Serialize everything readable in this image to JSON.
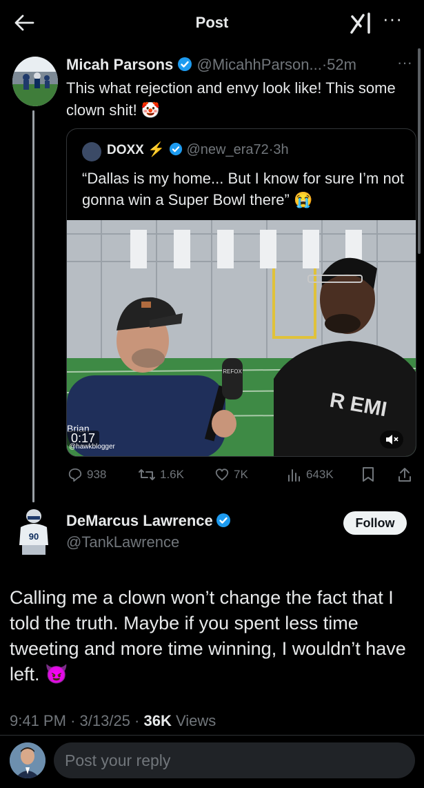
{
  "header": {
    "title": "Post",
    "back_icon": "arrow-left-icon",
    "grok_icon": "grok-icon",
    "more": "···"
  },
  "post1": {
    "name": "Micah Parsons",
    "handle": "@MicahhParson...",
    "sep": "·",
    "time": "52m",
    "more": "···",
    "text": "This what rejection and envy look like! This some clown shit! 🤡",
    "quote": {
      "name": "DOXX",
      "bolt": "⚡",
      "handle": "@new_era72",
      "sep": "·",
      "time": "3h",
      "text": "“Dallas is my home... But I know for sure I’m not gonna win a Super Bowl there” 😭",
      "video": {
        "timer": "0:17",
        "overlay_name": "Brian",
        "overlay_handle": "@hawkblogger",
        "mic_label": "REFOX",
        "hoodie_text": "R EMI",
        "mute_icon": "speaker-muted-icon"
      }
    },
    "actions": {
      "replies": "938",
      "reposts": "1.6K",
      "likes": "7K",
      "views": "643K"
    }
  },
  "post2": {
    "name": "DeMarcus Lawrence",
    "handle": "@TankLawrence",
    "follow_label": "Follow",
    "text": "Calling me a clown won’t change the fact that I told the truth. Maybe if you spent less time tweeting and more time winning, I wouldn’t have left. 😈",
    "time": "9:41 PM",
    "date": "3/13/25",
    "views_count": "36K",
    "views_label": "Views",
    "sep": "·"
  },
  "reply": {
    "placeholder": "Post your reply"
  },
  "colors": {
    "background": "#000000",
    "text": "#e7e9ea",
    "muted": "#71767b",
    "verified": "#1d9bf0",
    "follow_bg": "#eff3f4"
  }
}
